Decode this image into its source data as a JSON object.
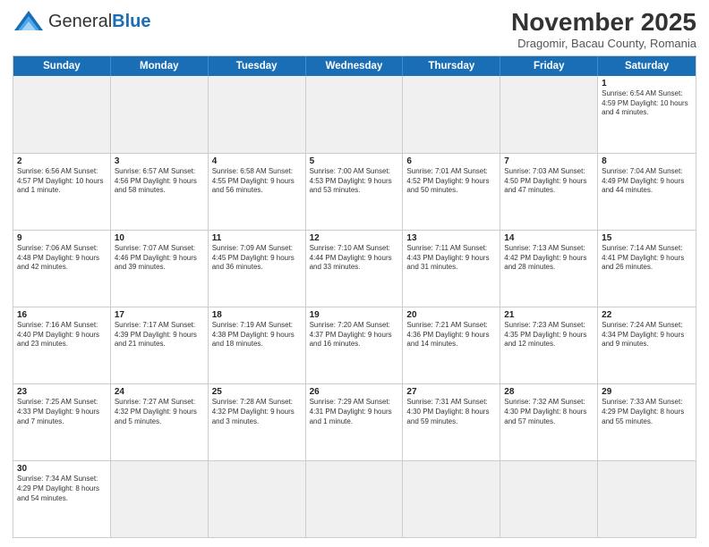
{
  "header": {
    "logo_general": "General",
    "logo_blue": "Blue",
    "month_year": "November 2025",
    "location": "Dragomir, Bacau County, Romania"
  },
  "days_of_week": [
    "Sunday",
    "Monday",
    "Tuesday",
    "Wednesday",
    "Thursday",
    "Friday",
    "Saturday"
  ],
  "weeks": [
    [
      {
        "day": "",
        "info": "",
        "empty": true
      },
      {
        "day": "",
        "info": "",
        "empty": true
      },
      {
        "day": "",
        "info": "",
        "empty": true
      },
      {
        "day": "",
        "info": "",
        "empty": true
      },
      {
        "day": "",
        "info": "",
        "empty": true
      },
      {
        "day": "",
        "info": "",
        "empty": true
      },
      {
        "day": "1",
        "info": "Sunrise: 6:54 AM\nSunset: 4:59 PM\nDaylight: 10 hours\nand 4 minutes."
      }
    ],
    [
      {
        "day": "2",
        "info": "Sunrise: 6:56 AM\nSunset: 4:57 PM\nDaylight: 10 hours\nand 1 minute."
      },
      {
        "day": "3",
        "info": "Sunrise: 6:57 AM\nSunset: 4:56 PM\nDaylight: 9 hours\nand 58 minutes."
      },
      {
        "day": "4",
        "info": "Sunrise: 6:58 AM\nSunset: 4:55 PM\nDaylight: 9 hours\nand 56 minutes."
      },
      {
        "day": "5",
        "info": "Sunrise: 7:00 AM\nSunset: 4:53 PM\nDaylight: 9 hours\nand 53 minutes."
      },
      {
        "day": "6",
        "info": "Sunrise: 7:01 AM\nSunset: 4:52 PM\nDaylight: 9 hours\nand 50 minutes."
      },
      {
        "day": "7",
        "info": "Sunrise: 7:03 AM\nSunset: 4:50 PM\nDaylight: 9 hours\nand 47 minutes."
      },
      {
        "day": "8",
        "info": "Sunrise: 7:04 AM\nSunset: 4:49 PM\nDaylight: 9 hours\nand 44 minutes."
      }
    ],
    [
      {
        "day": "9",
        "info": "Sunrise: 7:06 AM\nSunset: 4:48 PM\nDaylight: 9 hours\nand 42 minutes."
      },
      {
        "day": "10",
        "info": "Sunrise: 7:07 AM\nSunset: 4:46 PM\nDaylight: 9 hours\nand 39 minutes."
      },
      {
        "day": "11",
        "info": "Sunrise: 7:09 AM\nSunset: 4:45 PM\nDaylight: 9 hours\nand 36 minutes."
      },
      {
        "day": "12",
        "info": "Sunrise: 7:10 AM\nSunset: 4:44 PM\nDaylight: 9 hours\nand 33 minutes."
      },
      {
        "day": "13",
        "info": "Sunrise: 7:11 AM\nSunset: 4:43 PM\nDaylight: 9 hours\nand 31 minutes."
      },
      {
        "day": "14",
        "info": "Sunrise: 7:13 AM\nSunset: 4:42 PM\nDaylight: 9 hours\nand 28 minutes."
      },
      {
        "day": "15",
        "info": "Sunrise: 7:14 AM\nSunset: 4:41 PM\nDaylight: 9 hours\nand 26 minutes."
      }
    ],
    [
      {
        "day": "16",
        "info": "Sunrise: 7:16 AM\nSunset: 4:40 PM\nDaylight: 9 hours\nand 23 minutes."
      },
      {
        "day": "17",
        "info": "Sunrise: 7:17 AM\nSunset: 4:39 PM\nDaylight: 9 hours\nand 21 minutes."
      },
      {
        "day": "18",
        "info": "Sunrise: 7:19 AM\nSunset: 4:38 PM\nDaylight: 9 hours\nand 18 minutes."
      },
      {
        "day": "19",
        "info": "Sunrise: 7:20 AM\nSunset: 4:37 PM\nDaylight: 9 hours\nand 16 minutes."
      },
      {
        "day": "20",
        "info": "Sunrise: 7:21 AM\nSunset: 4:36 PM\nDaylight: 9 hours\nand 14 minutes."
      },
      {
        "day": "21",
        "info": "Sunrise: 7:23 AM\nSunset: 4:35 PM\nDaylight: 9 hours\nand 12 minutes."
      },
      {
        "day": "22",
        "info": "Sunrise: 7:24 AM\nSunset: 4:34 PM\nDaylight: 9 hours\nand 9 minutes."
      }
    ],
    [
      {
        "day": "23",
        "info": "Sunrise: 7:25 AM\nSunset: 4:33 PM\nDaylight: 9 hours\nand 7 minutes."
      },
      {
        "day": "24",
        "info": "Sunrise: 7:27 AM\nSunset: 4:32 PM\nDaylight: 9 hours\nand 5 minutes."
      },
      {
        "day": "25",
        "info": "Sunrise: 7:28 AM\nSunset: 4:32 PM\nDaylight: 9 hours\nand 3 minutes."
      },
      {
        "day": "26",
        "info": "Sunrise: 7:29 AM\nSunset: 4:31 PM\nDaylight: 9 hours\nand 1 minute."
      },
      {
        "day": "27",
        "info": "Sunrise: 7:31 AM\nSunset: 4:30 PM\nDaylight: 8 hours\nand 59 minutes."
      },
      {
        "day": "28",
        "info": "Sunrise: 7:32 AM\nSunset: 4:30 PM\nDaylight: 8 hours\nand 57 minutes."
      },
      {
        "day": "29",
        "info": "Sunrise: 7:33 AM\nSunset: 4:29 PM\nDaylight: 8 hours\nand 55 minutes."
      }
    ],
    [
      {
        "day": "30",
        "info": "Sunrise: 7:34 AM\nSunset: 4:29 PM\nDaylight: 8 hours\nand 54 minutes."
      },
      {
        "day": "",
        "info": "",
        "empty": true
      },
      {
        "day": "",
        "info": "",
        "empty": true
      },
      {
        "day": "",
        "info": "",
        "empty": true
      },
      {
        "day": "",
        "info": "",
        "empty": true
      },
      {
        "day": "",
        "info": "",
        "empty": true
      },
      {
        "day": "",
        "info": "",
        "empty": true
      }
    ]
  ]
}
